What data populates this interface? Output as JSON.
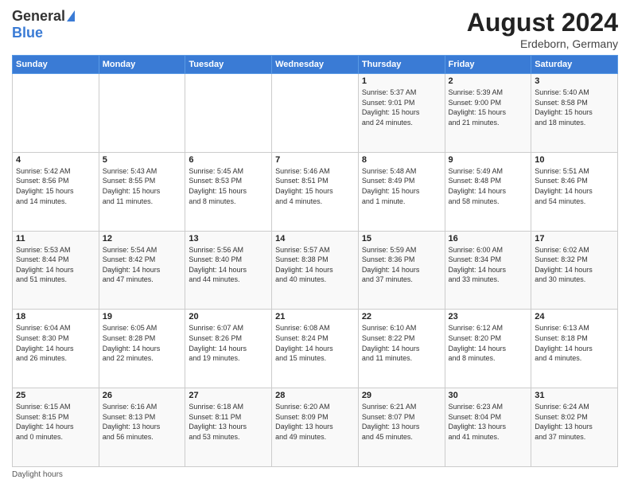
{
  "header": {
    "logo_general": "General",
    "logo_blue": "Blue",
    "title": "August 2024",
    "location": "Erdeborn, Germany"
  },
  "footer": {
    "note": "Daylight hours"
  },
  "days_of_week": [
    "Sunday",
    "Monday",
    "Tuesday",
    "Wednesday",
    "Thursday",
    "Friday",
    "Saturday"
  ],
  "weeks": [
    [
      {
        "day": "",
        "info": ""
      },
      {
        "day": "",
        "info": ""
      },
      {
        "day": "",
        "info": ""
      },
      {
        "day": "",
        "info": ""
      },
      {
        "day": "1",
        "info": "Sunrise: 5:37 AM\nSunset: 9:01 PM\nDaylight: 15 hours\nand 24 minutes."
      },
      {
        "day": "2",
        "info": "Sunrise: 5:39 AM\nSunset: 9:00 PM\nDaylight: 15 hours\nand 21 minutes."
      },
      {
        "day": "3",
        "info": "Sunrise: 5:40 AM\nSunset: 8:58 PM\nDaylight: 15 hours\nand 18 minutes."
      }
    ],
    [
      {
        "day": "4",
        "info": "Sunrise: 5:42 AM\nSunset: 8:56 PM\nDaylight: 15 hours\nand 14 minutes."
      },
      {
        "day": "5",
        "info": "Sunrise: 5:43 AM\nSunset: 8:55 PM\nDaylight: 15 hours\nand 11 minutes."
      },
      {
        "day": "6",
        "info": "Sunrise: 5:45 AM\nSunset: 8:53 PM\nDaylight: 15 hours\nand 8 minutes."
      },
      {
        "day": "7",
        "info": "Sunrise: 5:46 AM\nSunset: 8:51 PM\nDaylight: 15 hours\nand 4 minutes."
      },
      {
        "day": "8",
        "info": "Sunrise: 5:48 AM\nSunset: 8:49 PM\nDaylight: 15 hours\nand 1 minute."
      },
      {
        "day": "9",
        "info": "Sunrise: 5:49 AM\nSunset: 8:48 PM\nDaylight: 14 hours\nand 58 minutes."
      },
      {
        "day": "10",
        "info": "Sunrise: 5:51 AM\nSunset: 8:46 PM\nDaylight: 14 hours\nand 54 minutes."
      }
    ],
    [
      {
        "day": "11",
        "info": "Sunrise: 5:53 AM\nSunset: 8:44 PM\nDaylight: 14 hours\nand 51 minutes."
      },
      {
        "day": "12",
        "info": "Sunrise: 5:54 AM\nSunset: 8:42 PM\nDaylight: 14 hours\nand 47 minutes."
      },
      {
        "day": "13",
        "info": "Sunrise: 5:56 AM\nSunset: 8:40 PM\nDaylight: 14 hours\nand 44 minutes."
      },
      {
        "day": "14",
        "info": "Sunrise: 5:57 AM\nSunset: 8:38 PM\nDaylight: 14 hours\nand 40 minutes."
      },
      {
        "day": "15",
        "info": "Sunrise: 5:59 AM\nSunset: 8:36 PM\nDaylight: 14 hours\nand 37 minutes."
      },
      {
        "day": "16",
        "info": "Sunrise: 6:00 AM\nSunset: 8:34 PM\nDaylight: 14 hours\nand 33 minutes."
      },
      {
        "day": "17",
        "info": "Sunrise: 6:02 AM\nSunset: 8:32 PM\nDaylight: 14 hours\nand 30 minutes."
      }
    ],
    [
      {
        "day": "18",
        "info": "Sunrise: 6:04 AM\nSunset: 8:30 PM\nDaylight: 14 hours\nand 26 minutes."
      },
      {
        "day": "19",
        "info": "Sunrise: 6:05 AM\nSunset: 8:28 PM\nDaylight: 14 hours\nand 22 minutes."
      },
      {
        "day": "20",
        "info": "Sunrise: 6:07 AM\nSunset: 8:26 PM\nDaylight: 14 hours\nand 19 minutes."
      },
      {
        "day": "21",
        "info": "Sunrise: 6:08 AM\nSunset: 8:24 PM\nDaylight: 14 hours\nand 15 minutes."
      },
      {
        "day": "22",
        "info": "Sunrise: 6:10 AM\nSunset: 8:22 PM\nDaylight: 14 hours\nand 11 minutes."
      },
      {
        "day": "23",
        "info": "Sunrise: 6:12 AM\nSunset: 8:20 PM\nDaylight: 14 hours\nand 8 minutes."
      },
      {
        "day": "24",
        "info": "Sunrise: 6:13 AM\nSunset: 8:18 PM\nDaylight: 14 hours\nand 4 minutes."
      }
    ],
    [
      {
        "day": "25",
        "info": "Sunrise: 6:15 AM\nSunset: 8:15 PM\nDaylight: 14 hours\nand 0 minutes."
      },
      {
        "day": "26",
        "info": "Sunrise: 6:16 AM\nSunset: 8:13 PM\nDaylight: 13 hours\nand 56 minutes."
      },
      {
        "day": "27",
        "info": "Sunrise: 6:18 AM\nSunset: 8:11 PM\nDaylight: 13 hours\nand 53 minutes."
      },
      {
        "day": "28",
        "info": "Sunrise: 6:20 AM\nSunset: 8:09 PM\nDaylight: 13 hours\nand 49 minutes."
      },
      {
        "day": "29",
        "info": "Sunrise: 6:21 AM\nSunset: 8:07 PM\nDaylight: 13 hours\nand 45 minutes."
      },
      {
        "day": "30",
        "info": "Sunrise: 6:23 AM\nSunset: 8:04 PM\nDaylight: 13 hours\nand 41 minutes."
      },
      {
        "day": "31",
        "info": "Sunrise: 6:24 AM\nSunset: 8:02 PM\nDaylight: 13 hours\nand 37 minutes."
      }
    ]
  ]
}
